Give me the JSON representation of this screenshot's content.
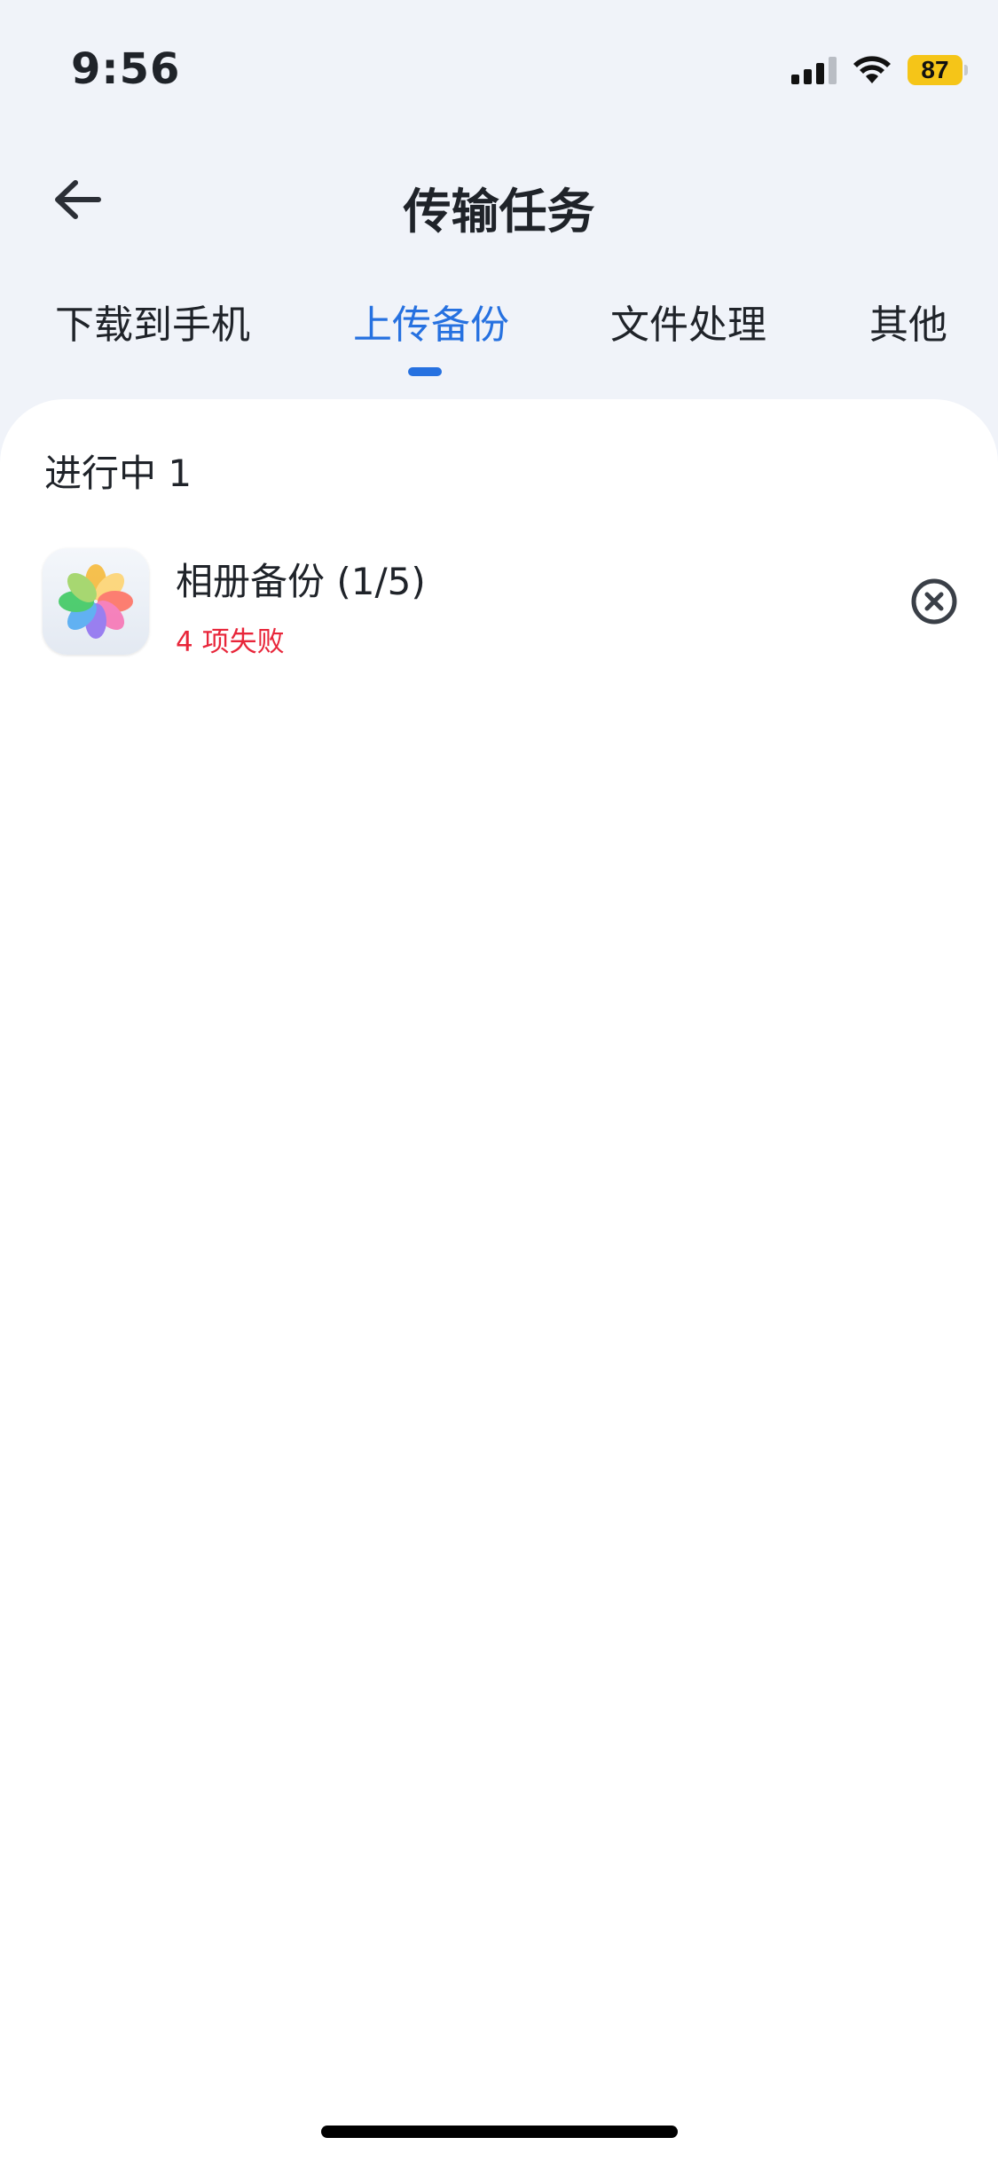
{
  "status_bar": {
    "time": "9:56",
    "battery": "87",
    "icons": [
      "cellular-signal-icon",
      "wifi-icon",
      "battery-icon"
    ]
  },
  "header": {
    "title": "传输任务",
    "back_icon": "arrow-left-icon"
  },
  "tabs": [
    {
      "label": "下载到手机",
      "active": false
    },
    {
      "label": "上传备份",
      "active": true
    },
    {
      "label": "文件处理",
      "active": false
    },
    {
      "label": "其他",
      "active": false
    }
  ],
  "section": {
    "title": "进行中 1"
  },
  "tasks": [
    {
      "icon": "photos-icon",
      "title": "相册备份 (1/5)",
      "status": "4 项失败",
      "action_icon": "close-circle-icon"
    }
  ],
  "colors": {
    "accent": "#2671e0",
    "error": "#e8263a",
    "background": "#f0f3f9",
    "battery": "#f5c518"
  }
}
